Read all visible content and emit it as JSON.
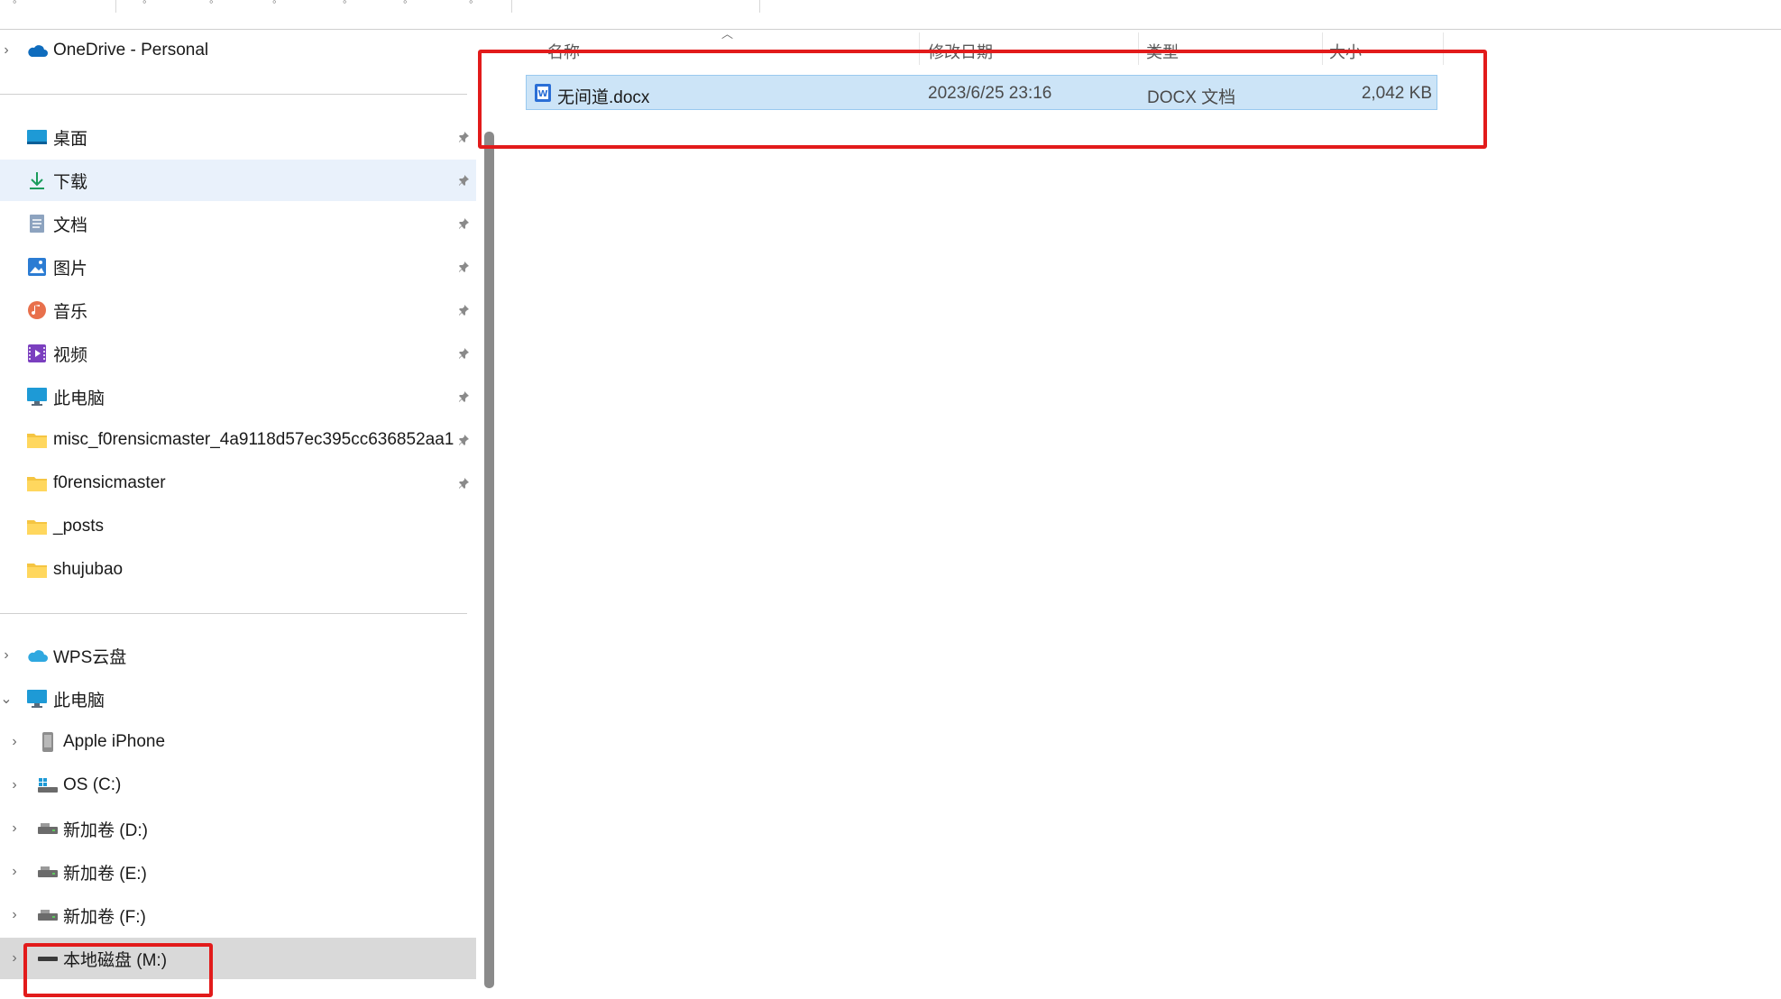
{
  "nav": {
    "onedrive": "OneDrive - Personal",
    "quick": [
      {
        "label": "桌面",
        "icon": "desktop-icon"
      },
      {
        "label": "下载",
        "icon": "download-icon"
      },
      {
        "label": "文档",
        "icon": "documents-icon"
      },
      {
        "label": "图片",
        "icon": "pictures-icon"
      },
      {
        "label": "音乐",
        "icon": "music-icon"
      },
      {
        "label": "视频",
        "icon": "videos-icon"
      },
      {
        "label": "此电脑",
        "icon": "computer-icon"
      },
      {
        "label": "misc_f0rensicmaster_4a9118d57ec395cc636852aa1",
        "icon": "folder-icon"
      },
      {
        "label": "f0rensicmaster",
        "icon": "folder-icon"
      },
      {
        "label": "_posts",
        "icon": "folder-icon"
      },
      {
        "label": "shujubao",
        "icon": "folder-icon"
      }
    ],
    "wps": "WPS云盘",
    "this_pc": "此电脑",
    "drives": [
      {
        "label": "Apple iPhone",
        "icon": "phone-icon"
      },
      {
        "label": "OS (C:)",
        "icon": "windows-drive-icon"
      },
      {
        "label": "新加卷 (D:)",
        "icon": "drive-icon"
      },
      {
        "label": "新加卷 (E:)",
        "icon": "drive-icon"
      },
      {
        "label": "新加卷 (F:)",
        "icon": "drive-icon"
      },
      {
        "label": "本地磁盘 (M:)",
        "icon": "usb-drive-icon"
      }
    ]
  },
  "list": {
    "columns": {
      "name": "名称",
      "modified": "修改日期",
      "type": "类型",
      "size": "大小"
    },
    "files": [
      {
        "name": "无间道.docx",
        "modified": "2023/6/25 23:16",
        "type": "DOCX 文档",
        "size": "2,042 KB",
        "icon": "word-doc-icon"
      }
    ]
  },
  "colors": {
    "highlight": "#e21b1b",
    "selected_row": "#cce4f7",
    "selected_nav": "#e9f1fb"
  }
}
